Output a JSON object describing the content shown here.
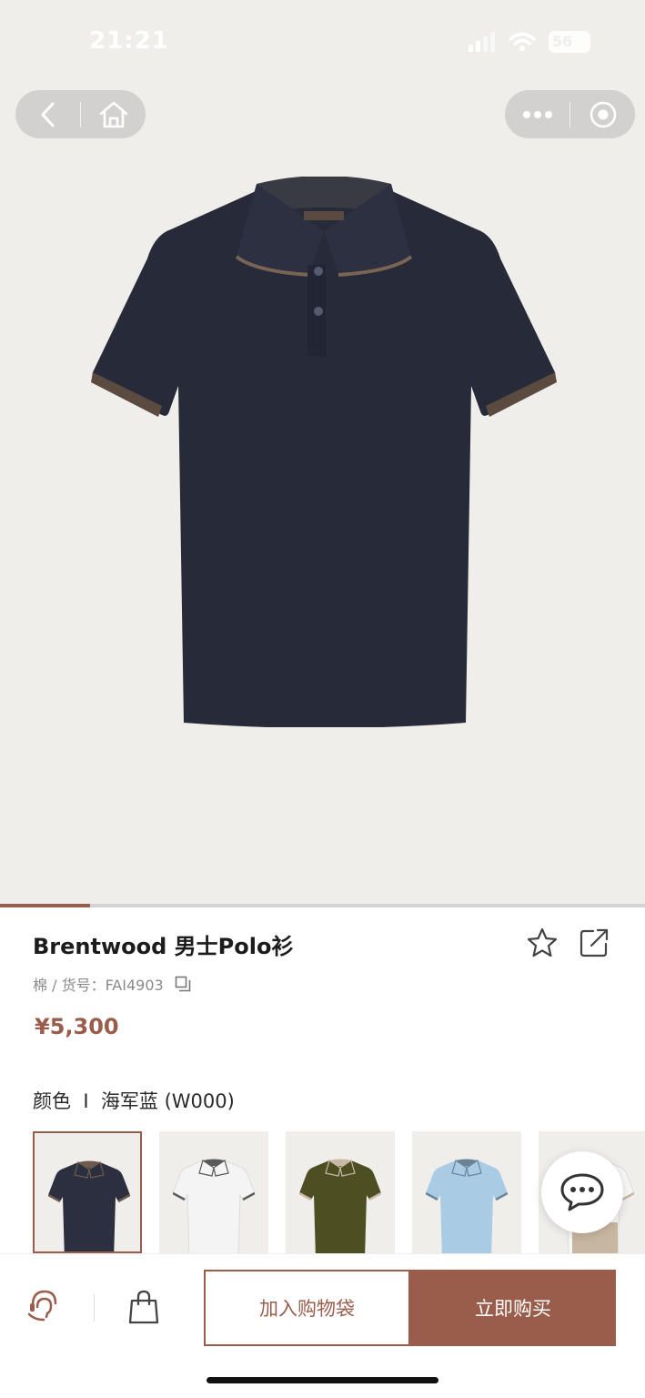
{
  "status_bar": {
    "time": "21:21",
    "battery": "56"
  },
  "nav": {
    "back_icon": "chevron-left-icon",
    "home_icon": "home-icon",
    "more_icon": "more-dots-icon",
    "close_icon": "target-circle-icon"
  },
  "gallery": {
    "progress": 0.14
  },
  "product": {
    "title": "Brentwood 男士Polo衫",
    "meta": "棉 / 货号：FAI4903",
    "price": "¥5,300",
    "color_label": "颜色  I  海军蓝 (W000)"
  },
  "swatches": [
    {
      "name": "navy",
      "body": "#2b2f3f",
      "trim": "#6e5a4d",
      "selected": true
    },
    {
      "name": "white",
      "body": "#f4f4f4",
      "trim": "#5a5a5a",
      "selected": false
    },
    {
      "name": "olive",
      "body": "#4d4f22",
      "trim": "#c9b8a8",
      "selected": false
    },
    {
      "name": "light-blue",
      "body": "#a9cbe3",
      "trim": "#6a8396",
      "selected": false
    },
    {
      "name": "white-beige",
      "body": "#f6f6f6",
      "trim": "#c7b6a0",
      "selected": false
    }
  ],
  "bottom_bar": {
    "service_icon": "customer-service-icon",
    "bag_icon": "shopping-bag-icon",
    "add_to_bag": "加入购物袋",
    "buy_now": "立即购买"
  },
  "colors": {
    "accent": "#9b5d4b",
    "hero_bg": "#efeeeb",
    "shirt": "#272a38"
  }
}
